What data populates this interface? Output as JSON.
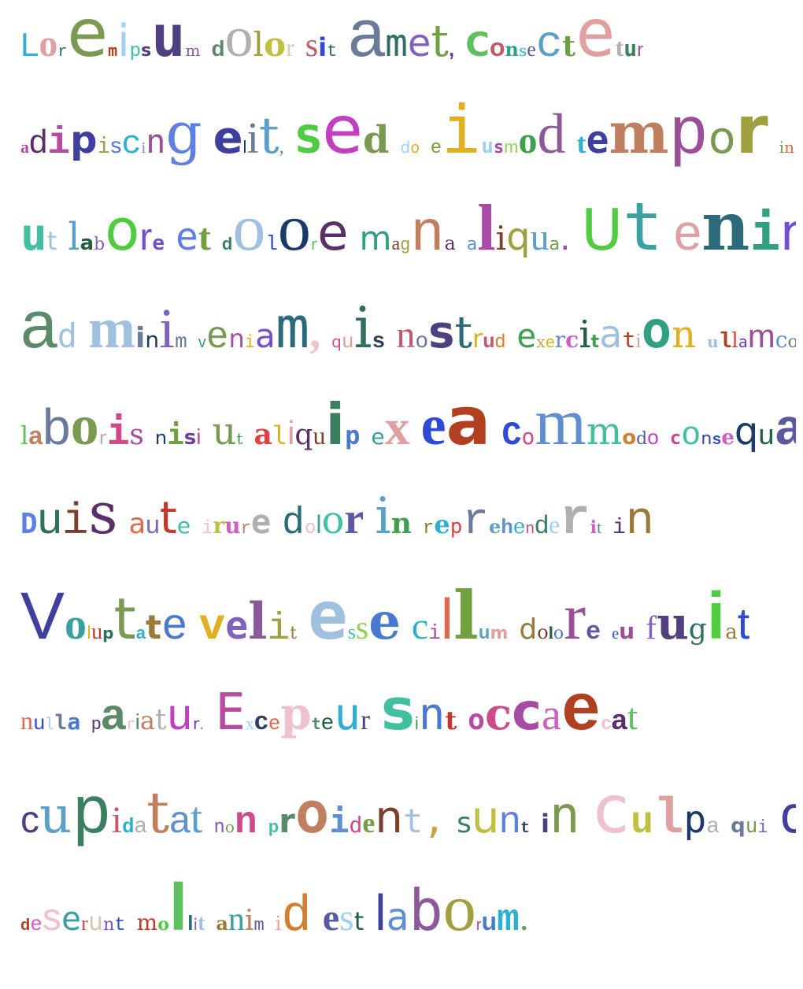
{
  "lines": [
    "Loremipsum dolor  sit amet, Consectetur",
    "adipiscing elit, Sed do eiusmod tempor incididunt",
    "ut labore et dolore magna aliqua. Ut enim",
    "ad minim  veniam, quis nostrud exercitation ullamco",
    "laboris nisi ut   aliquip ex ea Commodo consequat.",
    "Duis aute irure dolor in reprehenderit in",
    "Voluptate velit esse cillum dolore eu fugiat",
    "nulla  pariatur. Excepteur sint  occaecat",
    "cupidatat non  proident, sunt in culpa qui officia",
    "deserunt mollit anim id est laborum."
  ],
  "palette": [
    "#c0392b",
    "#7a9a52",
    "#9b4f96",
    "#a64ca6",
    "#d7c9b4",
    "#c040c0",
    "#4fcc3f",
    "#7b3f2d",
    "#e0b020",
    "#5f8fd0",
    "#2f6f5f",
    "#2f4ad8",
    "#5aa0c8",
    "#b84aa0",
    "#8ed44f",
    "#6a3fa0",
    "#c05a6a",
    "#5a8a6a",
    "#3f3f9f",
    "#c8a04a",
    "#30a080",
    "#d04a8a",
    "#6a7a9a",
    "#e06a50",
    "#3aa0a0",
    "#b0b0b0",
    "#4a7ad0",
    "#a0d0f0",
    "#70a040",
    "#9a7a3a",
    "#40a050",
    "#2f3f5f",
    "#c0c040",
    "#5a2f6a",
    "#2a6a7a",
    "#e04040",
    "#8a5a9a",
    "#a0c0e0",
    "#60c060",
    "#d08030",
    "#f0c0d0",
    "#504080",
    "#1a3a6a",
    "#8060c0",
    "#40c0a0",
    "#b04020",
    "#6080e0",
    "#a0a040",
    "#3a8060",
    "#d060c0",
    "#5a5aa0",
    "#e0a0a0",
    "#206040",
    "#c08060",
    "#7050d0",
    "#30b0d0"
  ]
}
